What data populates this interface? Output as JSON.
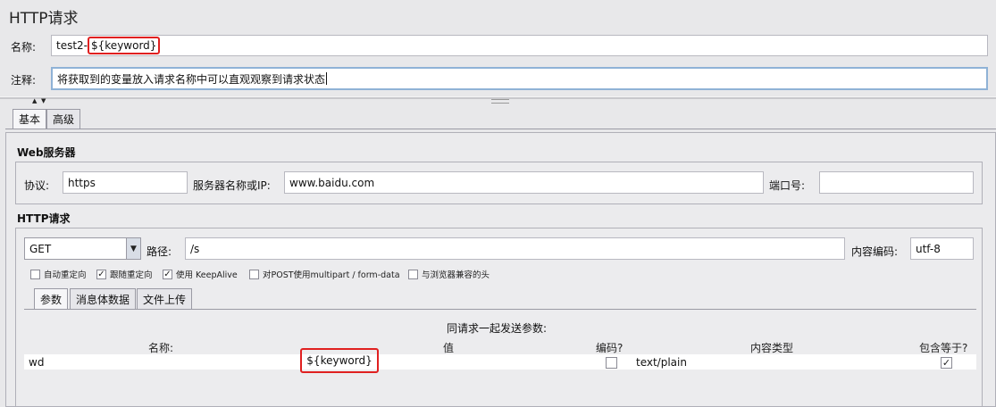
{
  "window": {
    "title": "HTTP请求"
  },
  "name_field": {
    "label": "名称:",
    "value_prefix": "test2-",
    "value_highlight": "${keyword}"
  },
  "comment_field": {
    "label": "注释:",
    "value": "将获取到的变量放入请求名称中可以直观观察到请求状态"
  },
  "tabs": [
    {
      "label": "基本"
    },
    {
      "label": "高级"
    }
  ],
  "web_server": {
    "section_label": "Web服务器",
    "protocol_label": "协议:",
    "protocol_value": "https",
    "server_label": "服务器名称或IP:",
    "server_value": "www.baidu.com",
    "port_label": "端口号:",
    "port_value": ""
  },
  "http_request": {
    "section_label": "HTTP请求",
    "method": "GET",
    "path_label": "路径:",
    "path_value": "/s",
    "encoding_label": "内容编码:",
    "encoding_value": "utf-8",
    "options": [
      {
        "label": "自动重定向",
        "checked": false
      },
      {
        "label": "跟随重定向",
        "checked": true
      },
      {
        "label": "使用 KeepAlive",
        "checked": true
      },
      {
        "label": "对POST使用multipart / form-data",
        "checked": false
      },
      {
        "label": "与浏览器兼容的头",
        "checked": false
      }
    ]
  },
  "sub_tabs": [
    {
      "label": "参数"
    },
    {
      "label": "消息体数据"
    },
    {
      "label": "文件上传"
    }
  ],
  "params": {
    "caption": "同请求一起发送参数:",
    "headers": {
      "name": "名称:",
      "value": "值",
      "encode": "编码?",
      "content_type": "内容类型",
      "include_equals": "包含等于?"
    },
    "rows": [
      {
        "name": "wd",
        "value": "${keyword}",
        "encode": false,
        "content_type": "text/plain",
        "include_equals": true
      }
    ]
  },
  "colors": {
    "highlight_border": "#e02020",
    "background": "#e8e8ea"
  },
  "icons": {
    "dropdown": "chevron-down-icon",
    "check": "check-icon"
  }
}
